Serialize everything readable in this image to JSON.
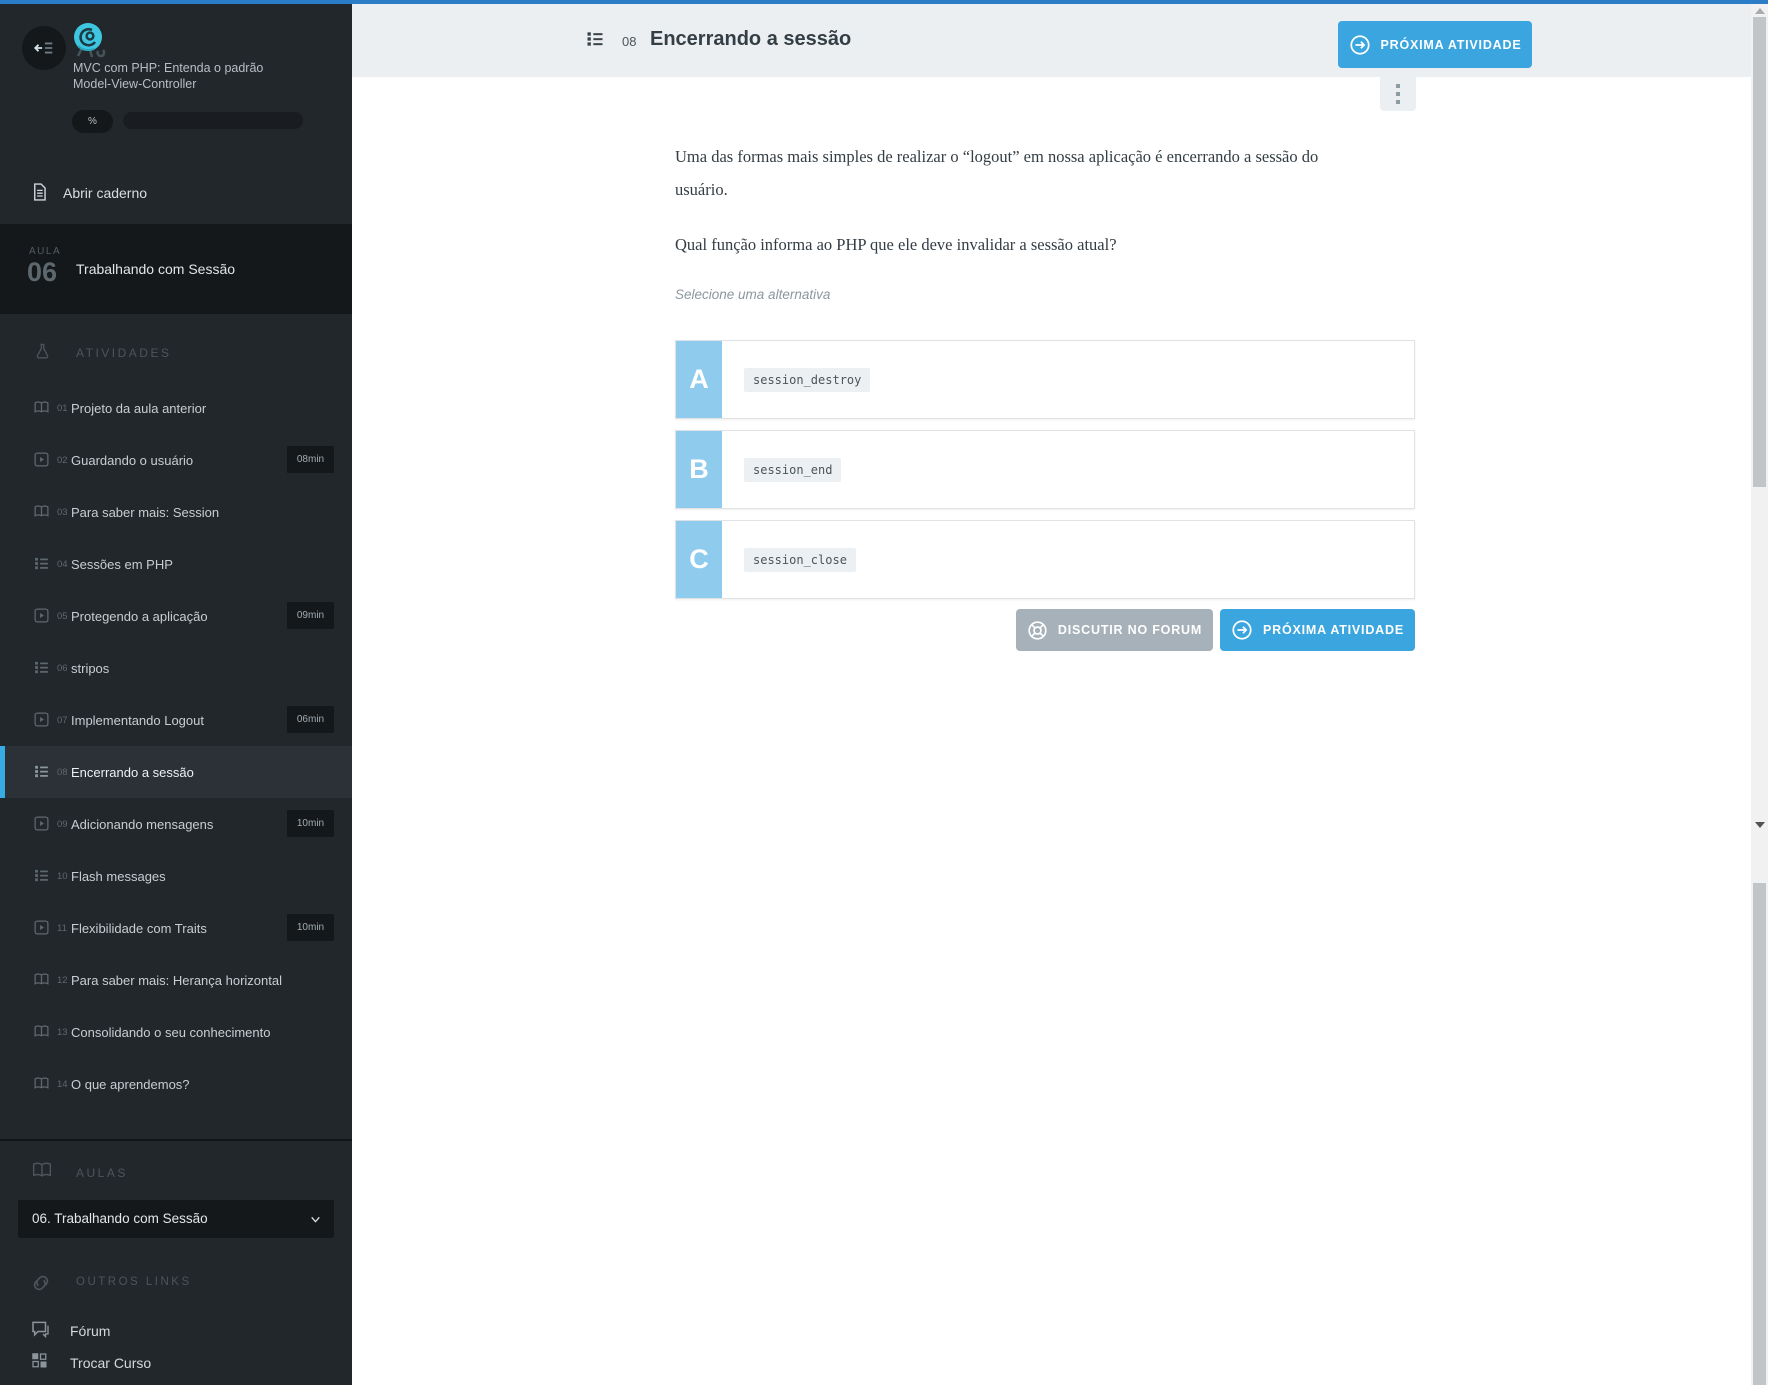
{
  "course": {
    "title_line1": "MVC com PHP: Entenda o padrão",
    "title_line2": "Model-View-Controller",
    "progress_label": "%"
  },
  "sidebar": {
    "open_notebook_label": "Abrir caderno",
    "lesson_badge": {
      "label": "AULA",
      "number": "06",
      "title": "Trabalhando com Sessão"
    },
    "activities_header": "ATIVIDADES",
    "activities": [
      {
        "num": "01",
        "label": "Projeto da aula anterior",
        "type": "book"
      },
      {
        "num": "02",
        "label": "Guardando o usuário",
        "type": "video",
        "duration": "08min"
      },
      {
        "num": "03",
        "label": "Para saber mais: Session",
        "type": "book"
      },
      {
        "num": "04",
        "label": "Sessões em PHP",
        "type": "quiz"
      },
      {
        "num": "05",
        "label": "Protegendo a aplicação",
        "type": "video",
        "duration": "09min"
      },
      {
        "num": "06",
        "label": "stripos",
        "type": "quiz"
      },
      {
        "num": "07",
        "label": "Implementando Logout",
        "type": "video",
        "duration": "06min"
      },
      {
        "num": "08",
        "label": "Encerrando a sessão",
        "type": "quiz",
        "active": true
      },
      {
        "num": "09",
        "label": "Adicionando mensagens",
        "type": "video",
        "duration": "10min"
      },
      {
        "num": "10",
        "label": "Flash messages",
        "type": "quiz"
      },
      {
        "num": "11",
        "label": "Flexibilidade com Traits",
        "type": "video",
        "duration": "10min"
      },
      {
        "num": "12",
        "label": "Para saber mais: Herança horizontal",
        "type": "book"
      },
      {
        "num": "13",
        "label": "Consolidando o seu conhecimento",
        "type": "book"
      },
      {
        "num": "14",
        "label": "O que aprendemos?",
        "type": "book"
      }
    ],
    "aulas_header": "AULAS",
    "lesson_select_value": "06. Trabalhando com Sessão",
    "other_links_header": "OUTROS LINKS",
    "forum_label": "Fórum",
    "change_course_label": "Trocar Curso"
  },
  "header": {
    "activity_number": "08",
    "activity_title": "Encerrando a sessão",
    "next_button_label": "PRÓXIMA ATIVIDADE"
  },
  "question": {
    "paragraph1": "Uma das formas mais simples de realizar o “logout” em nossa aplicação é encerrando a sessão do usuário.",
    "paragraph2": "Qual função informa ao PHP que ele deve invalidar a sessão atual?",
    "hint": "Selecione uma alternativa",
    "options": [
      {
        "letter": "A",
        "code": "session_destroy"
      },
      {
        "letter": "B",
        "code": "session_end"
      },
      {
        "letter": "C",
        "code": "session_close"
      }
    ],
    "forum_button_label": "DISCUTIR NO FORUM",
    "next_button_label": "PRÓXIMA ATIVIDADE"
  },
  "colors": {
    "top_line": "#2b7dc7",
    "primary_blue": "#3aa5df",
    "option_letter_blue": "#8fcbec",
    "active_item_blue": "#36ace2",
    "sidebar_bg": "#22272b",
    "sidebar_dark": "#14181b",
    "header_bg": "#eceff1",
    "gray_button": "#a6b1b9"
  }
}
